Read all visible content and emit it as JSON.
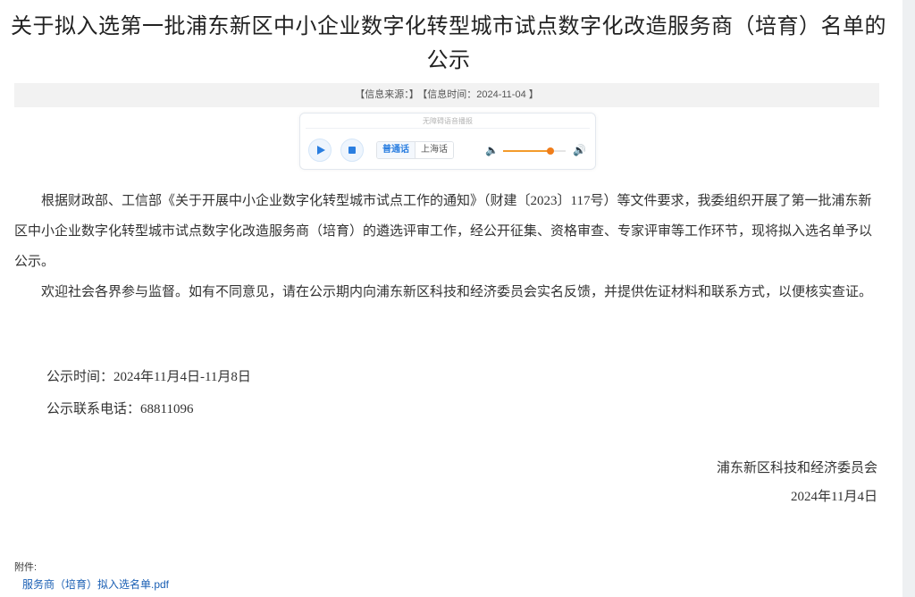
{
  "article": {
    "title_line1": "关于拟入选第一批浦东新区中小企业数字化转型城市试点数字化改造服务商（培育）名单的",
    "title_line2": "公示",
    "meta": {
      "source": "【信息来源：】",
      "time": "【信息时间：2024-11-04 】"
    }
  },
  "player": {
    "caption": "无障碍语音播报",
    "play_icon": "play-icon",
    "stop_icon": "stop-icon",
    "lang_mandarin": "普通话",
    "lang_shanghai": "上海话",
    "volume_level": 0.75,
    "volume_low_icon": "volume-low-icon",
    "volume_high_icon": "volume-high-icon",
    "accent": "#f07d1a",
    "button_color": "#2a7ee0"
  },
  "body": {
    "para1": "根据财政部、工信部《关于开展中小企业数字化转型城市试点工作的通知》（财建〔2023〕117号）等文件要求，我委组织开展了第一批浦东新区中小企业数字化转型城市试点数字化改造服务商（培育）的遴选评审工作，经公开征集、资格审查、专家评审等工作环节，现将拟入选名单予以公示。",
    "para2": "欢迎社会各界参与监督。如有不同意见，请在公示期内向浦东新区科技和经济委员会实名反馈，并提供佐证材料和联系方式，以便核实查证。",
    "period": "公示时间：2024年11月4日-11月8日",
    "phone": "公示联系电话：68811096",
    "signer": "浦东新区科技和经济委员会",
    "date": "2024年11月4日"
  },
  "attachments": {
    "label": "附件:",
    "file": "服务商（培育）拟入选名单.pdf"
  }
}
